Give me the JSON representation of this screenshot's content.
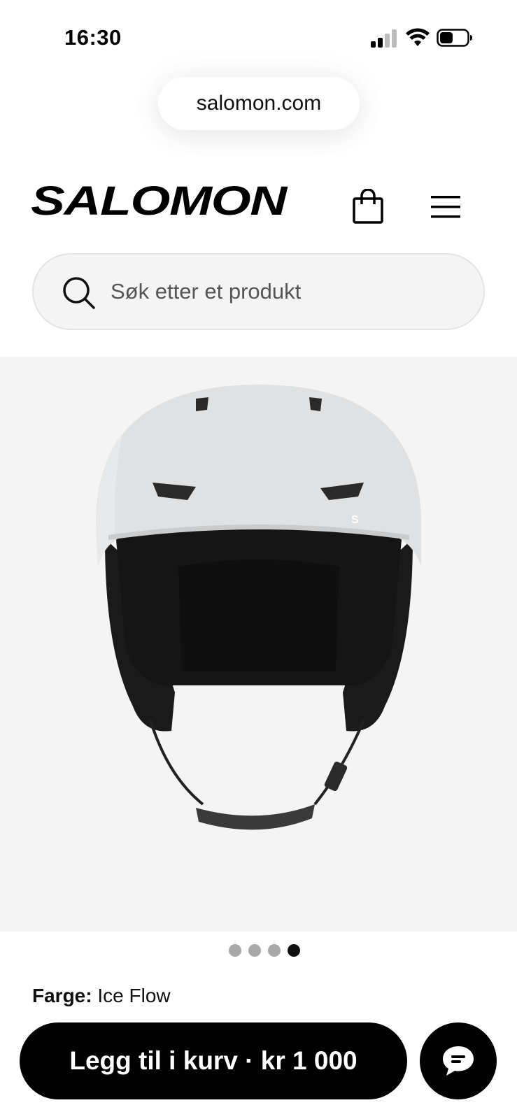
{
  "status_bar": {
    "time": "16:30",
    "icons": [
      "signal-icon",
      "wifi-icon",
      "battery-icon"
    ]
  },
  "browser": {
    "url": "salomon.com"
  },
  "header": {
    "logo_text": "SALOMON",
    "icons": [
      "shopping-bag-icon",
      "hamburger-menu-icon"
    ]
  },
  "search": {
    "placeholder": "Søk etter et produkt",
    "value": ""
  },
  "gallery": {
    "image_count": 4,
    "active_index": 3
  },
  "product": {
    "color_label": "Farge:",
    "color_value": " Ice Flow"
  },
  "cta": {
    "add_to_cart_label": "Legg til i kurv · kr 1 000"
  },
  "chat": {
    "icon": "chat-bubble-icon"
  },
  "colors": {
    "primary": "#000000",
    "background": "#ffffff",
    "gallery_bg": "#f4f4f4",
    "search_bg": "#f4f4f4"
  }
}
